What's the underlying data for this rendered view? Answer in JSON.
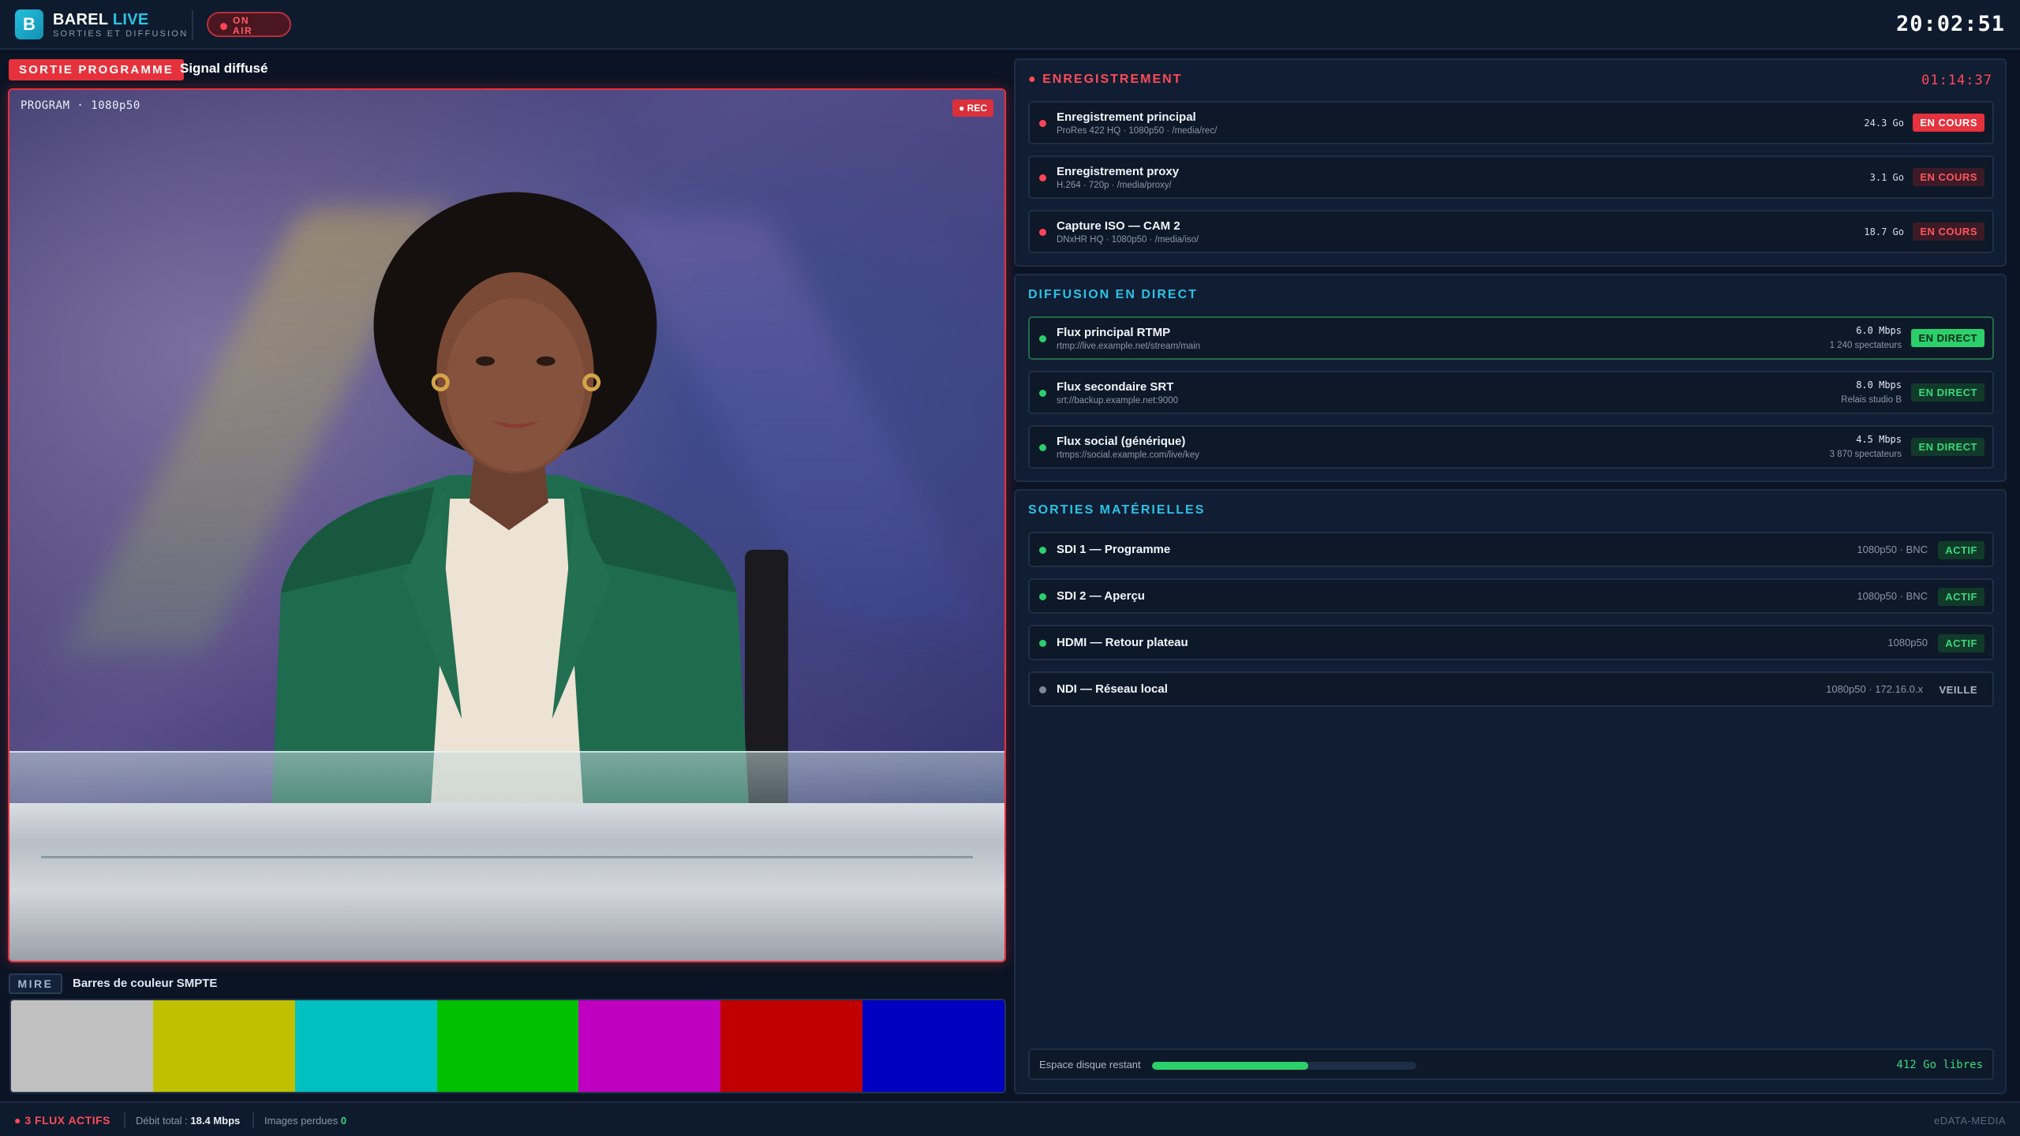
{
  "header": {
    "logo_letter": "B",
    "brand_main": "BAREL",
    "brand_accent": "LIVE",
    "brand_sub": "SORTIES ET DIFFUSION",
    "on_air": "ON AIR",
    "clock": "20:02:51"
  },
  "program": {
    "tag": "SORTIE PROGRAMME",
    "caption": "Signal diffusé",
    "monitor_label": "PROGRAM · 1080p50",
    "rec_badge": "● REC"
  },
  "test_pattern": {
    "tag": "MIRE",
    "caption": "Barres de couleur SMPTE",
    "bars": [
      "#c0c0c0",
      "#c0c000",
      "#00c0c0",
      "#00c000",
      "#c000c0",
      "#c00000",
      "#0000c0"
    ]
  },
  "recording": {
    "title": "● ENREGISTREMENT",
    "timer": "01:14:37",
    "items": [
      {
        "name": "Enregistrement principal",
        "detail": "ProRes 422 HQ · 1080p50 · /media/rec/",
        "size": "24.3 Go",
        "status": "EN COURS"
      },
      {
        "name": "Enregistrement proxy",
        "detail": "H.264 · 720p · /media/proxy/",
        "size": "3.1 Go",
        "status": "EN COURS"
      },
      {
        "name": "Capture ISO — CAM 2",
        "detail": "DNxHR HQ · 1080p50 · /media/iso/",
        "size": "18.7 Go",
        "status": "EN COURS"
      }
    ]
  },
  "streaming": {
    "title": "DIFFUSION EN DIRECT",
    "items": [
      {
        "name": "Flux principal RTMP",
        "url": "rtmp://live.example.net/stream/main",
        "rate": "6.0 Mbps",
        "audience": "1 240 spectateurs",
        "status": "EN DIRECT"
      },
      {
        "name": "Flux secondaire SRT",
        "url": "srt://backup.example.net:9000",
        "rate": "8.0 Mbps",
        "audience": "Relais studio B",
        "status": "EN DIRECT"
      },
      {
        "name": "Flux social (générique)",
        "url": "rtmps://social.example.com/live/key",
        "rate": "4.5 Mbps",
        "audience": "3 870 spectateurs",
        "status": "EN DIRECT"
      }
    ]
  },
  "outputs": {
    "title": "SORTIES MATÉRIELLES",
    "items": [
      {
        "name": "SDI 1 — Programme",
        "meta": "1080p50 · BNC",
        "status": "ACTIF"
      },
      {
        "name": "SDI 2 — Aperçu",
        "meta": "1080p50 · BNC",
        "status": "ACTIF"
      },
      {
        "name": "HDMI — Retour plateau",
        "meta": "1080p50",
        "status": "ACTIF"
      },
      {
        "name": "NDI — Réseau local",
        "meta": "1080p50 · 172.16.0.x",
        "status": "VEILLE"
      }
    ],
    "disk_label": "Espace disque restant",
    "disk_used_fraction": 0.59,
    "disk_free": "412 Go libres"
  },
  "footer": {
    "active": "● 3 FLUX ACTIFS",
    "throughput_label": "Débit total :",
    "throughput_value": "18.4 Mbps",
    "dropped_label": "Images perdues",
    "dropped_value": "0",
    "brand": "eDATA-MEDIA"
  },
  "colors": {
    "accent": "#28c3e6",
    "live_red": "#e6323d",
    "ok_green": "#2bd06a",
    "standby_gray": "#7c8798"
  }
}
